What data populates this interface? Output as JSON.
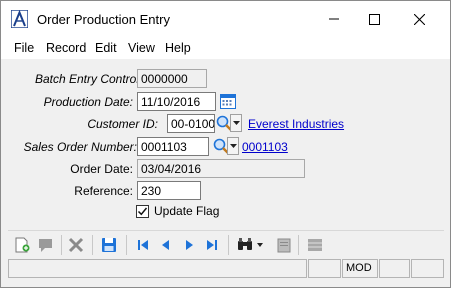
{
  "window": {
    "title": "Order Production Entry",
    "logo_icon": "a-logo-icon",
    "controls": [
      "minimize-icon",
      "maximize-icon",
      "close-icon"
    ]
  },
  "menu": {
    "items": [
      "File",
      "Record",
      "Edit",
      "View",
      "Help"
    ]
  },
  "form": {
    "batch_entry_control": {
      "label": "Batch Entry Control",
      "value": "0000000"
    },
    "production_date": {
      "label": "Production Date:",
      "value": "11/10/2016",
      "icon": "calendar-icon"
    },
    "customer_id": {
      "label": "Customer ID:",
      "value": "00-0100",
      "link": "Everest Industries",
      "icon": "magnifier-icon"
    },
    "sales_order_number": {
      "label": "Sales Order Number:",
      "value": "0001103",
      "link": "0001103",
      "icon": "magnifier-icon"
    },
    "order_date": {
      "label": "Order Date:",
      "value": "03/04/2016"
    },
    "reference": {
      "label": "Reference:",
      "value": "230"
    },
    "update_flag": {
      "label": "Update Flag",
      "checked": true
    }
  },
  "toolbar": {
    "buttons": [
      "new-record-icon",
      "comment-icon",
      "delete-icon",
      "save-icon",
      "first-record-icon",
      "previous-record-icon",
      "next-record-icon",
      "last-record-icon",
      "binoculars-icon",
      "chevron-down-icon",
      "print-icon",
      "grid-icon"
    ]
  },
  "statusbar": {
    "mode": "MOD"
  },
  "colors": {
    "link": "#0000cc",
    "accent_blue": "#1e73d8",
    "background": "#f0f0f0"
  }
}
